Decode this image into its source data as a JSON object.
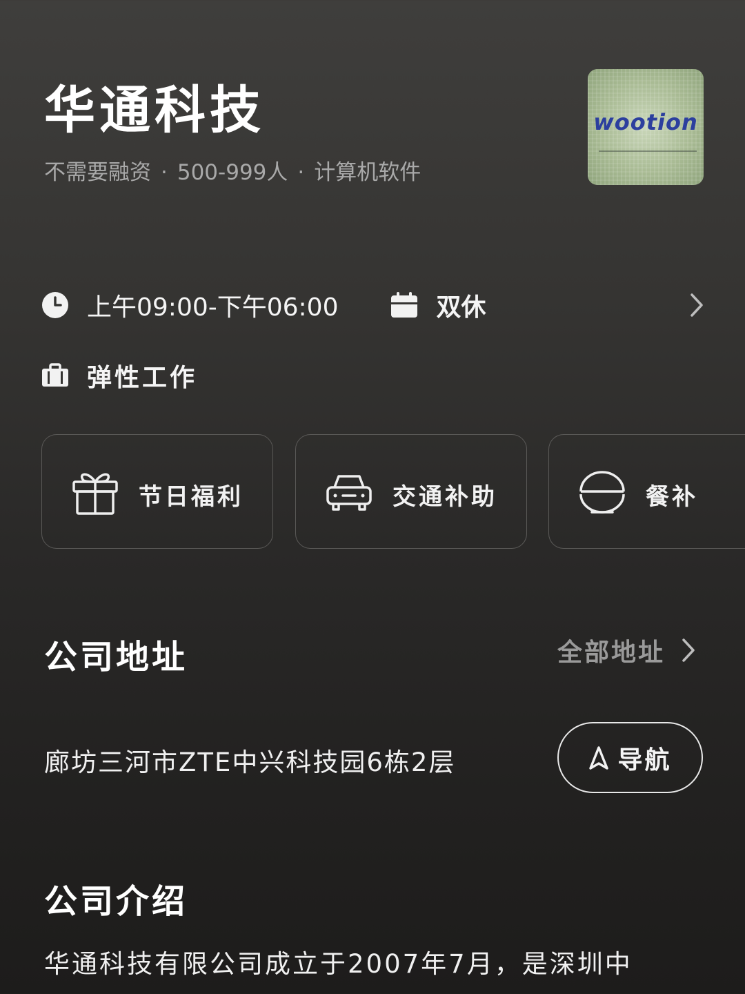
{
  "company": {
    "name": "华通科技",
    "financing": "不需要融资",
    "size": "500-999人",
    "industry": "计算机软件",
    "separator": "·",
    "logo_text": "wootion"
  },
  "work": {
    "hours": "上午09:00-下午06:00",
    "rest": "双休",
    "style": "弹性工作"
  },
  "benefits": [
    {
      "label": "节日福利",
      "icon": "gift-icon"
    },
    {
      "label": "交通补助",
      "icon": "car-icon"
    },
    {
      "label": "餐补",
      "icon": "rice-bowl-icon"
    }
  ],
  "address_section": {
    "title": "公司地址",
    "all_link": "全部地址",
    "address": "廊坊三河市ZTE中兴科技园6栋2层",
    "nav_label": "导航"
  },
  "intro_section": {
    "title": "公司介绍",
    "text": "华通科技有限公司成立于2007年7月，是深圳中"
  },
  "colors": {
    "background_top": "#3f3e3c",
    "background_bottom": "#1d1c1b",
    "primary_text": "#ffffff",
    "secondary_text": "#a9a9a9",
    "card_border": "#5b5a58",
    "logo_text": "#2c3f9e"
  }
}
